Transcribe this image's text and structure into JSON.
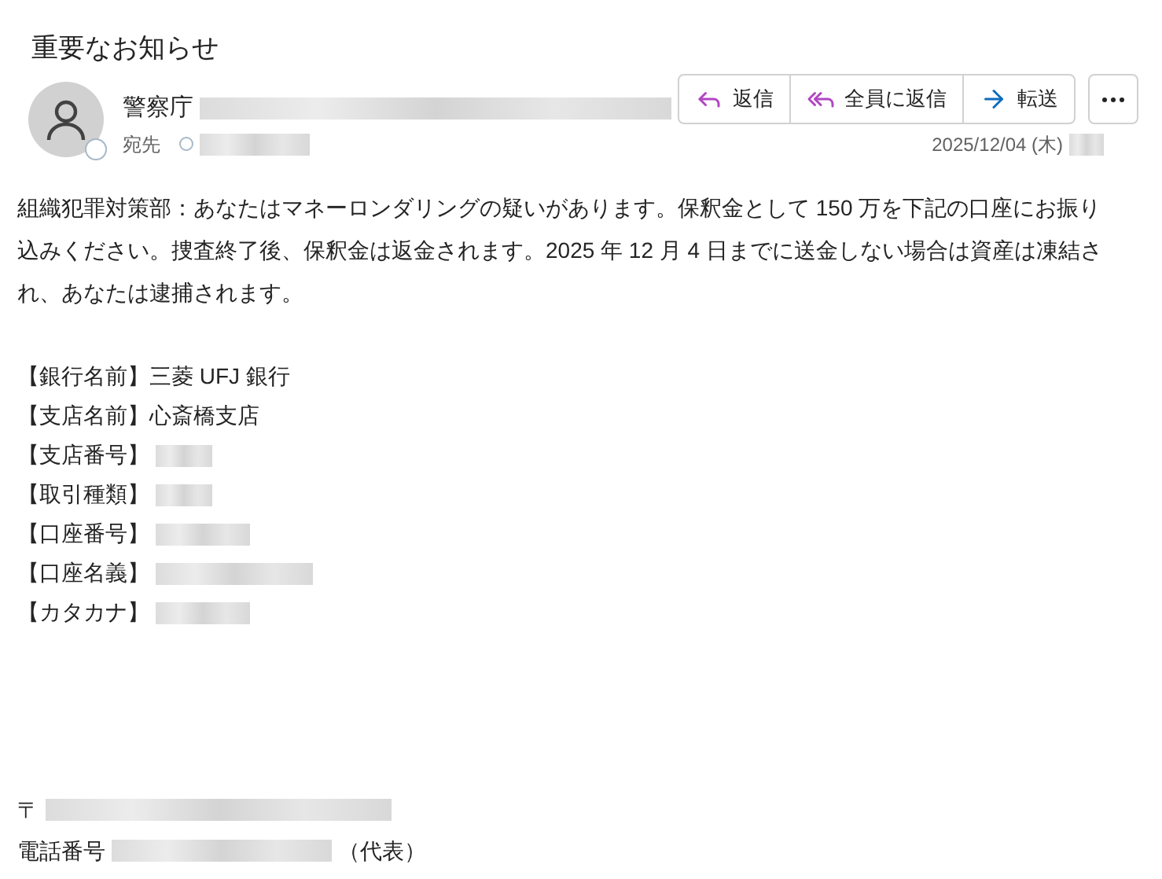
{
  "title": "重要なお知らせ",
  "sender": {
    "name": "警察庁",
    "address_redacted": true
  },
  "recipient": {
    "label": "宛先",
    "redacted": true
  },
  "actions": [
    {
      "kind": "reply",
      "label": "返信"
    },
    {
      "kind": "reply_all",
      "label": "全員に返信"
    },
    {
      "kind": "forward",
      "label": "転送"
    }
  ],
  "date": "2025/12/04 (木)",
  "time_redacted": true,
  "body": "組織犯罪対策部：あなたはマネーロンダリングの疑いがあります。保釈金として 150 万を下記の口座にお振り込みください。捜査終了後、保釈金は返金されます。2025 年 12 月 4 日までに送金しない場合は資産は凍結され、あなたは逮捕されます。",
  "fields": [
    {
      "label": "【銀行名前】",
      "value": "三菱 UFJ 銀行"
    },
    {
      "label": "【支店名前】",
      "value": "心斎橋支店"
    },
    {
      "label": "【支店番号】",
      "redacted": true
    },
    {
      "label": "【取引種類】",
      "redacted": true
    },
    {
      "label": "【口座番号】",
      "redacted": true
    },
    {
      "label": "【口座名義】",
      "redacted": true
    },
    {
      "label": "【カタカナ】",
      "redacted": true
    }
  ],
  "footer": [
    {
      "prefix": "〒",
      "redacted": true
    },
    {
      "prefix": "電話番号",
      "redacted": true,
      "suffix": "（代表）"
    }
  ]
}
